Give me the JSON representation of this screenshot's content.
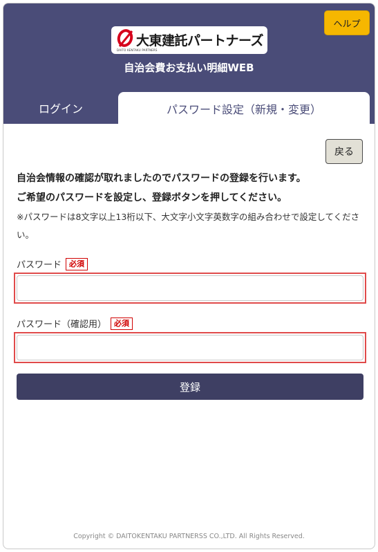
{
  "header": {
    "help_label": "ヘルプ",
    "logo_text": "大東建託パートナーズ",
    "logo_subtext": "DAITO KENTAKU PARTNERS",
    "app_title": "自治会費お支払い明細WEB"
  },
  "tabs": [
    {
      "label": "ログイン",
      "active": false
    },
    {
      "label": "パスワード設定（新規・変更）",
      "active": true
    }
  ],
  "main": {
    "back_label": "戻る",
    "message_line1": "自治会情報の確認が取れましたのでパスワードの登録を行います。",
    "message_line2": "ご希望のパスワードを設定し、登録ボタンを押してください。",
    "note": "※パスワードは8文字以上13桁以下、大文字小文字英数字の組み合わせで設定してください。",
    "fields": [
      {
        "label": "パスワード",
        "required_badge": "必須",
        "value": "",
        "placeholder": ""
      },
      {
        "label": "パスワード（確認用）",
        "required_badge": "必須",
        "value": "",
        "placeholder": ""
      }
    ],
    "submit_label": "登録"
  },
  "footer": {
    "copyright": "Copyright © DAITOKENTAKU PARTNERSS CO.,LTD. All Rights Reserved."
  },
  "colors": {
    "header_bg": "#4a4c78",
    "help_button": "#f6b700",
    "submit_button": "#3e3f63",
    "required_red": "#d00000",
    "field_error_border": "#e04a4a"
  }
}
